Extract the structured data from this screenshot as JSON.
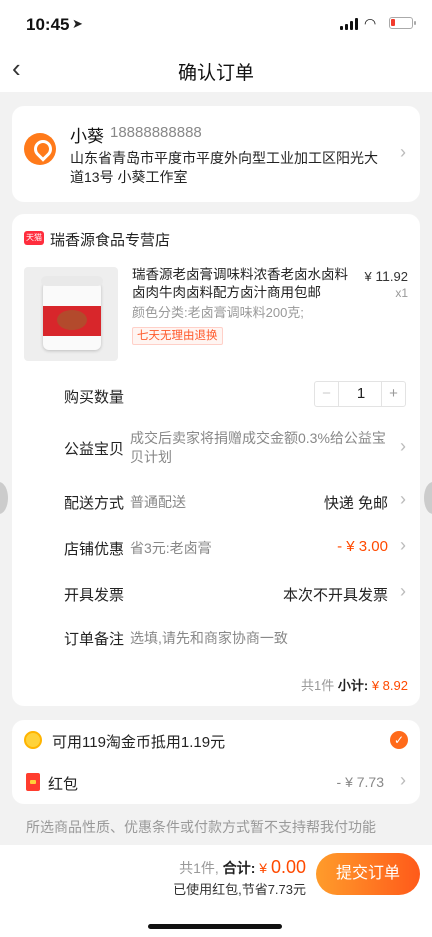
{
  "status_bar": {
    "time": "10:45"
  },
  "nav": {
    "title": "确认订单"
  },
  "address": {
    "name": "小葵",
    "phone": "18888888888",
    "line1": "山东省青岛市平度市平度外向型工业加工区阳光大道13",
    "line2": "号 小葵工作室"
  },
  "shop": {
    "badge": "天猫",
    "name": "瑞香源食品专营店"
  },
  "product": {
    "title": "瑞香源老卤膏调味料浓香老卤水卤料卤肉牛肉卤料配方卤汁商用包邮",
    "price_prefix": "¥",
    "price_int": "11",
    "price_dec": ".92",
    "qty_label": "x1",
    "sku": "颜色分类:老卤膏调味料200克;",
    "badge": "七天无理由退换"
  },
  "rows": {
    "quantity": {
      "label": "购买数量",
      "minus": "−",
      "value": "1",
      "plus": "+"
    },
    "charity": {
      "label": "公益宝贝",
      "value": "成交后卖家将捐赠成交金额0.3%给公益宝贝计划"
    },
    "shipping": {
      "label": "配送方式",
      "value": "普通配送",
      "right": "快递 免邮"
    },
    "discount": {
      "label": "店铺优惠",
      "value": "省3元:老卤膏",
      "right": "- ¥ 3.00"
    },
    "invoice": {
      "label": "开具发票",
      "right": "本次不开具发票"
    },
    "note": {
      "label": "订单备注",
      "placeholder": "选填,请先和商家协商一致"
    }
  },
  "subtotal": {
    "count": "共1件",
    "label": "小计:",
    "value": "¥ 8.92"
  },
  "coins": {
    "text": "可用119淘金币抵用1.19元",
    "checked": true
  },
  "red_packet": {
    "label": "红包",
    "value": "- ¥ 7.73"
  },
  "notice": "所选商品性质、优惠条件或付款方式暂不支持帮我付功能",
  "footer": {
    "count": "共1件,",
    "total_label": "合计:",
    "currency": "¥",
    "total": "0.00",
    "saved": "已使用红包,节省7.73元",
    "submit": "提交订单"
  },
  "colors": {
    "accent": "#ff4a00",
    "button_start": "#ff9c2b",
    "button_end": "#ff5a1a"
  }
}
